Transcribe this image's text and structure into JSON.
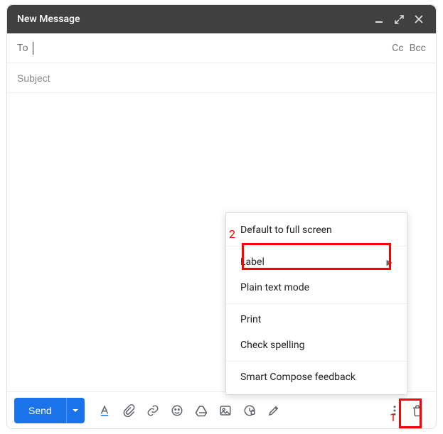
{
  "header": {
    "title": "New Message"
  },
  "fields": {
    "to_label": "To",
    "cc_label": "Cc",
    "bcc_label": "Bcc",
    "subject_placeholder": "Subject"
  },
  "toolbar": {
    "send_label": "Send"
  },
  "menu": {
    "default_full_screen": "Default to full screen",
    "label": "Label",
    "plain_text": "Plain text mode",
    "print": "Print",
    "check_spelling": "Check spelling",
    "smart_compose": "Smart Compose feedback"
  },
  "annotations": {
    "a1": "1",
    "a2": "2"
  }
}
